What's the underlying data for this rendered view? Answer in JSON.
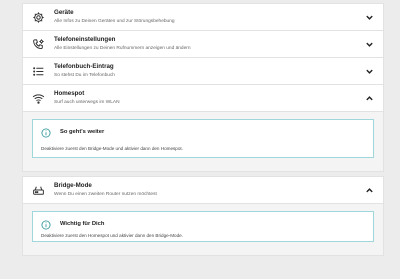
{
  "items": [
    {
      "title": "Geräte",
      "desc": "Alle Infos zu Deinen Geräten und zur Störungsbehebung",
      "icon": "gear-icon",
      "expanded": false
    },
    {
      "title": "Telefoneinstellungen",
      "desc": "Alle Einstellungen zu Deinen Rufnummern anzeigen und ändern",
      "icon": "phone-settings-icon",
      "expanded": false
    },
    {
      "title": "Telefonbuch-Eintrag",
      "desc": "So stehst Du im Telefonbuch",
      "icon": "list-icon",
      "expanded": false
    },
    {
      "title": "Homespot",
      "desc": "Surf auch unterwegs im WLAN",
      "icon": "wifi-icon",
      "expanded": true
    },
    {
      "title": "Bridge-Mode",
      "desc": "Wenn Du einen zweiten Router nutzen möchtest",
      "icon": "router-icon",
      "expanded": true
    }
  ],
  "homespot_info": {
    "title": "So geht's weiter",
    "text": "Deaktiviere zuerst den Bridge-Mode und aktivier dann den Homespot."
  },
  "bridge_info": {
    "title": "Wichtig für Dich",
    "text": "Deaktiviere zuerst den Homespot und aktivier dann den Bridge-Mode."
  },
  "colors": {
    "info_border": "#9fd7da",
    "info_icon": "#1c8c93"
  }
}
